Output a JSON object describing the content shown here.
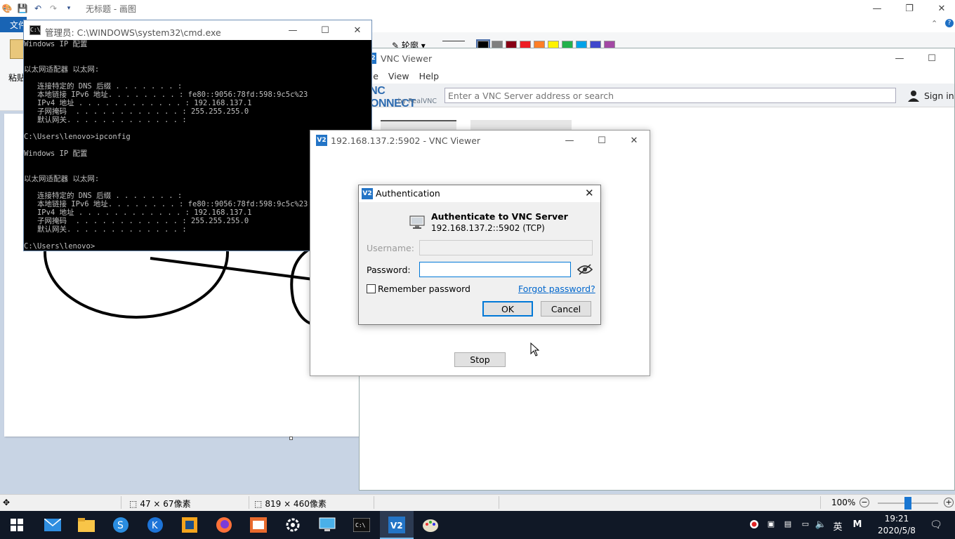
{
  "paint": {
    "title": "无标题 - 画图",
    "file_tab": "文件",
    "paste_label": "粘贴",
    "outline_label": "轮廓",
    "status": {
      "selection_size": "47 × 67像素",
      "canvas_size": "819 × 460像素",
      "zoom": "100%"
    },
    "palette": [
      "#000000",
      "#7f7f7f",
      "#880015",
      "#ed1c24",
      "#ff7f27",
      "#fff200",
      "#22b14c",
      "#00a2e8",
      "#3f48cc",
      "#a349a4"
    ]
  },
  "cmd": {
    "title": "管理员: C:\\WINDOWS\\system32\\cmd.exe",
    "lines": [
      "Windows IP 配置",
      "",
      "",
      "以太网适配器 以太网:",
      "",
      "   连接特定的 DNS 后缀 . . . . . . . :",
      "   本地链接 IPv6 地址. . . . . . . . : fe80::9056:78fd:598:9c5c%23",
      "   IPv4 地址 . . . . . . . . . . . . : 192.168.137.1",
      "   子网掩码  . . . . . . . . . . . . : 255.255.255.0",
      "   默认网关. . . . . . . . . . . . . :",
      "",
      "C:\\Users\\lenovo>ipconfig",
      "",
      "Windows IP 配置",
      "",
      "",
      "以太网适配器 以太网:",
      "",
      "   连接特定的 DNS 后缀 . . . . . . . :",
      "   本地链接 IPv6 地址. . . . . . . . : fe80::9056:78fd:598:9c5c%23",
      "   IPv4 地址 . . . . . . . . . . . . : 192.168.137.1",
      "   子网掩码  . . . . . . . . . . . . : 255.255.255.0",
      "   默认网关. . . . . . . . . . . . . :",
      "",
      "C:\\Users\\lenovo>"
    ]
  },
  "vnc_main": {
    "title": "VNC Viewer",
    "menu": [
      "File",
      "View",
      "Help"
    ],
    "brand_main": "VNC CONNECT",
    "brand_sub": "by RealVNC",
    "search_placeholder": "Enter a VNC Server address or search",
    "sign_in": "Sign in..."
  },
  "session": {
    "title": "192.168.137.2:5902 - VNC Viewer",
    "stop_label": "Stop"
  },
  "auth": {
    "title": "Authentication",
    "heading": "Authenticate to VNC Server",
    "server": "192.168.137.2::5902 (TCP)",
    "username_label": "Username:",
    "password_label": "Password:",
    "remember_label": "Remember password",
    "remember_checked": false,
    "forgot_link": "Forgot password?",
    "ok_label": "OK",
    "cancel_label": "Cancel"
  },
  "taskbar": {
    "clock_time": "19:21",
    "clock_date": "2020/5/8",
    "ime_lang": "英",
    "ime_mode": "M"
  },
  "colors": {
    "accent": "#0078d7",
    "vnc_blue": "#2374c6",
    "taskbar": "#101826"
  }
}
